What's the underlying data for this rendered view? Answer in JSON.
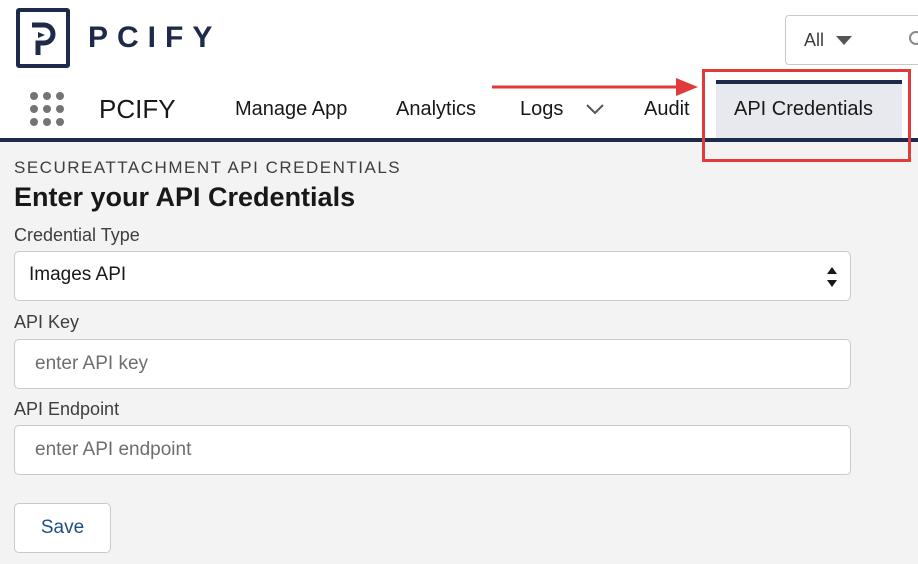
{
  "logo": {
    "text": "PCIFY",
    "icon": "pcify-logo-icon"
  },
  "search": {
    "scope": "All",
    "icon": "search-icon"
  },
  "nav": {
    "app_launcher_icon": "waffle-icon",
    "app_name": "PCIFY",
    "tabs": [
      {
        "label": "Manage App"
      },
      {
        "label": "Analytics"
      },
      {
        "label": "Logs",
        "has_dropdown": true
      },
      {
        "label": "Audit"
      },
      {
        "label": "API Credentials",
        "active": true
      }
    ]
  },
  "page": {
    "eyebrow": "SECUREATTACHMENT API CREDENTIALS",
    "title": "Enter your API Credentials"
  },
  "form": {
    "credential_type": {
      "label": "Credential Type",
      "value": "Images API"
    },
    "api_key": {
      "label": "API Key",
      "value": "",
      "placeholder": "enter API key"
    },
    "api_endpoint": {
      "label": "API Endpoint",
      "value": "",
      "placeholder": "enter API endpoint"
    },
    "save_label": "Save"
  },
  "colors": {
    "brand_navy": "#1d2a4a",
    "annotation_red": "#e03a3a",
    "button_text": "#1d4e89",
    "page_bg": "#f3f3f3"
  }
}
